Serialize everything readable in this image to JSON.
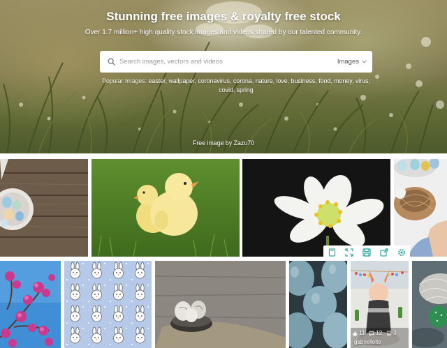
{
  "hero": {
    "title": "Stunning free images & royalty free stock",
    "subtitle": "Over 1.7 million+ high quality stock images and videos shared by our talented community.",
    "search": {
      "placeholder": "Search images, vectors and videos",
      "type_label": "Images"
    },
    "popular_label": "Popular Images:",
    "popular_tags": [
      "easter",
      "wallpaper",
      "coronavirus",
      "corona",
      "nature",
      "love",
      "business",
      "food",
      "money",
      "virus",
      "covid",
      "spring"
    ],
    "credit": "Free image by Zazu70"
  },
  "toolbar": {
    "icons": [
      "bookmark-icon",
      "fullscreen-icon",
      "save-icon",
      "share-icon",
      "settings-icon"
    ]
  },
  "hover_card": {
    "likes": "11",
    "comments": "12",
    "collections": "3",
    "username": "gabrielleite"
  },
  "colors": {
    "accent": "#2ec66d",
    "toolbar_icon": "#2aa8a0"
  }
}
